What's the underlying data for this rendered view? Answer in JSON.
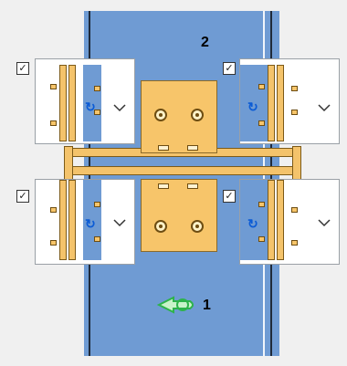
{
  "board": {
    "top_label": "2",
    "bottom_label": "1"
  },
  "checkboxes": [
    {
      "checked": true,
      "mark": "✓"
    },
    {
      "checked": true,
      "mark": "✓"
    },
    {
      "checked": true,
      "mark": "✓"
    },
    {
      "checked": true,
      "mark": "✓"
    }
  ],
  "colors": {
    "board": "#6f9bd3",
    "wood": "#f4c36b",
    "arrow": "#2db34a"
  },
  "icons": [
    "checkbox-icon",
    "chevron-down-icon",
    "rotate-icon",
    "bolt-icon",
    "arrow-left-icon"
  ]
}
